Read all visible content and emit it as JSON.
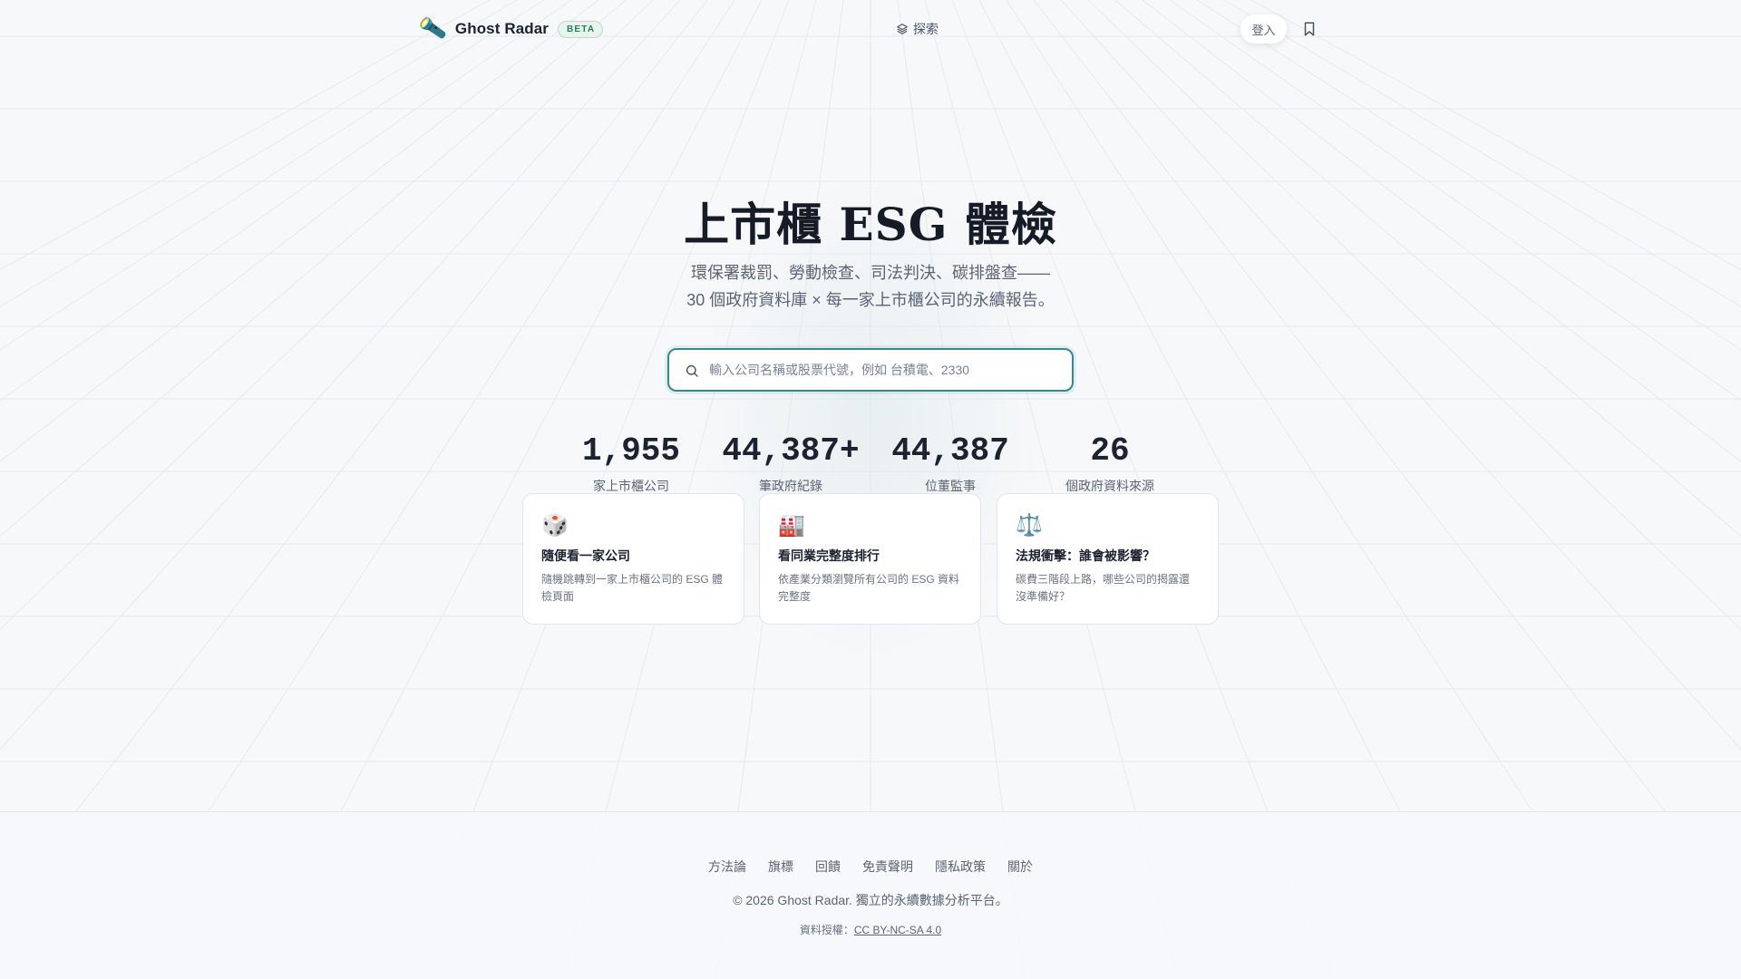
{
  "nav": {
    "brand_icon": "flashlight-icon",
    "brand_name": "Ghost Radar",
    "beta_badge": "BETA",
    "explore_label": "探索",
    "explore_icon": "layers-icon",
    "login_label": "登入",
    "bookmark_icon": "bookmark-icon"
  },
  "hero": {
    "title": "上市櫃 ESG 體檢",
    "subtitle_line1": "環保署裁罰、勞動檢查、司法判決、碳排盤查——",
    "subtitle_line2": "30 個政府資料庫 × 每一家上市櫃公司的永續報告。"
  },
  "search": {
    "icon": "search-icon",
    "value": "",
    "placeholder": "輸入公司名稱或股票代號，例如 台積電、2330"
  },
  "stats": [
    {
      "value": "1,955",
      "label": "家上市櫃公司"
    },
    {
      "value": "44,387+",
      "label": "筆政府紀錄"
    },
    {
      "value": "44,387",
      "label": "位董監事"
    },
    {
      "value": "26",
      "label": "個政府資料來源"
    }
  ],
  "cards": [
    {
      "icon": "🎲",
      "icon_name": "dice-icon",
      "title": "隨便看一家公司",
      "desc": "隨機跳轉到一家上市櫃公司的 ESG 體檢頁面"
    },
    {
      "icon": "🏭",
      "icon_name": "factory-icon",
      "title": "看同業完整度排行",
      "desc": "依產業分類瀏覽所有公司的 ESG 資料完整度"
    },
    {
      "icon": "⚖️",
      "icon_name": "scales-icon",
      "title": "法規衝擊：誰會被影響？",
      "desc": "碳費三階段上路，哪些公司的揭露還沒準備好？"
    }
  ],
  "footer": {
    "links": [
      "方法論",
      "旗標",
      "回饋",
      "免責聲明",
      "隱私政策",
      "關於"
    ],
    "copyright": "© 2026 Ghost Radar. 獨立的永續數據分析平台。",
    "license_prefix": "資料授權：",
    "license_link": "CC BY-NC-SA 4.0"
  },
  "colors": {
    "accent": "#2f8a93",
    "beta_text": "#2f7a63",
    "background": "#f7f8fa"
  }
}
